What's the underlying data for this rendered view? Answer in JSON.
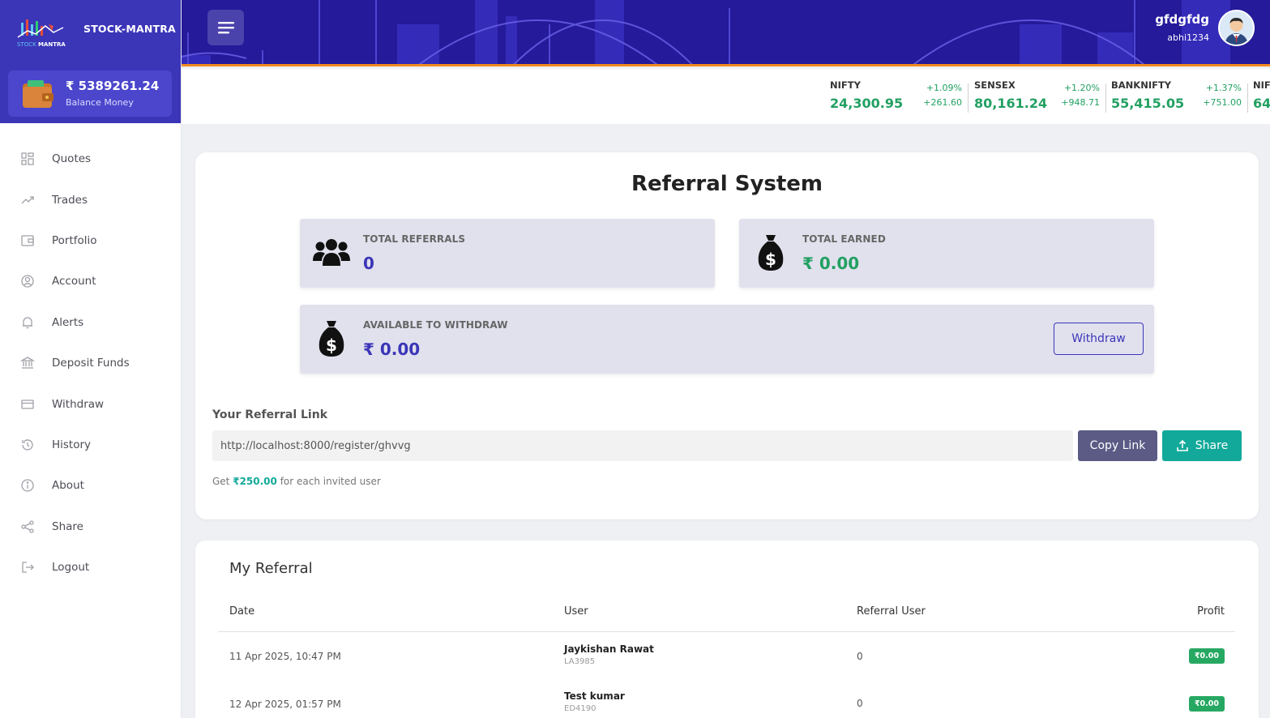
{
  "brand": {
    "name": "STOCK-MANTRA",
    "logo_text_left": "STOCK",
    "logo_text_right": "MANTRA"
  },
  "balance": {
    "amount": "₹ 5389261.24",
    "label": "Balance Money"
  },
  "menu": [
    {
      "label": "Quotes",
      "icon": "grid-icon"
    },
    {
      "label": "Trades",
      "icon": "trend-icon"
    },
    {
      "label": "Portfolio",
      "icon": "wallet-icon"
    },
    {
      "label": "Account",
      "icon": "user-circle-icon"
    },
    {
      "label": "Alerts",
      "icon": "bell-icon"
    },
    {
      "label": "Deposit Funds",
      "icon": "bank-icon"
    },
    {
      "label": "Withdraw",
      "icon": "card-icon"
    },
    {
      "label": "History",
      "icon": "history-icon"
    },
    {
      "label": "About",
      "icon": "info-icon"
    },
    {
      "label": "Share",
      "icon": "share-icon"
    },
    {
      "label": "Logout",
      "icon": "logout-icon"
    }
  ],
  "user": {
    "name": "gfdgfdg",
    "id": "abhi1234"
  },
  "ticker": [
    {
      "name": "NIFTY",
      "value": "24,300.95",
      "pct": "+1.09%",
      "change": "+261.60"
    },
    {
      "name": "SENSEX",
      "value": "80,161.24",
      "pct": "+1.20%",
      "change": "+948.71"
    },
    {
      "name": "BANKNIFTY",
      "value": "55,415.05",
      "pct": "+1.37%",
      "change": "+751.00"
    },
    {
      "name": "NIF",
      "value": "64"
    }
  ],
  "referral": {
    "title": "Referral System",
    "total_referrals_label": "TOTAL REFERRALS",
    "total_referrals_value": "0",
    "total_earned_label": "TOTAL EARNED",
    "total_earned_value": "₹ 0.00",
    "available_label": "AVAILABLE TO WITHDRAW",
    "available_value": "₹ 0.00",
    "withdraw_label": "Withdraw",
    "link_label": "Your Referral Link",
    "link_value": "http://localhost:8000/register/ghvvg",
    "copy_label": "Copy Link",
    "share_label": "Share",
    "note_prefix": "Get",
    "note_amount": "₹250.00",
    "note_suffix": "for each invited user"
  },
  "my_referral": {
    "title": "My Referral",
    "columns": [
      "Date",
      "User",
      "Referral User",
      "Profit"
    ],
    "rows": [
      {
        "date": "11 Apr 2025, 10:47 PM",
        "user": "Jaykishan Rawat",
        "code": "LA3985",
        "referral_user": "0",
        "profit": "₹0.00"
      },
      {
        "date": "12 Apr 2025, 01:57 PM",
        "user": "Test kumar",
        "code": "ED4190",
        "referral_user": "0",
        "profit": "₹0.00"
      }
    ]
  },
  "colors": {
    "primary": "#3b35b8",
    "header": "#241a9a",
    "accent_orange": "#f28a1d",
    "green": "#22a062",
    "teal": "#12a99a"
  }
}
